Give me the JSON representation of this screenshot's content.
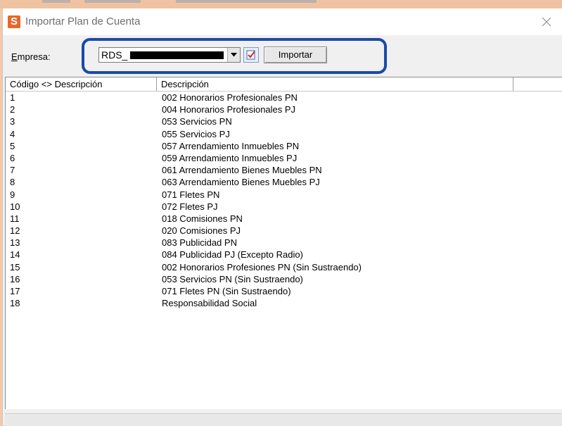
{
  "window": {
    "title": "Importar Plan de Cuenta",
    "icon_letter": "S"
  },
  "toolbar": {
    "empresa_label_underlined": "E",
    "empresa_label_rest": "mpresa:",
    "empresa_value": "RDS_",
    "import_label": "Importar"
  },
  "grid": {
    "headers": [
      "Código <> Descripción",
      "Descripción",
      ""
    ],
    "rows": [
      {
        "code": "1",
        "description": "002 Honorarios Profesionales PN"
      },
      {
        "code": "2",
        "description": "004 Honorarios Profesionales PJ"
      },
      {
        "code": "3",
        "description": "053 Servicios PN"
      },
      {
        "code": "4",
        "description": "055 Servicios PJ"
      },
      {
        "code": "5",
        "description": "057 Arrendamiento Inmuebles PN"
      },
      {
        "code": "6",
        "description": "059 Arrendamiento Inmuebles PJ"
      },
      {
        "code": "7",
        "description": "061 Arrendamiento Bienes Muebles PN"
      },
      {
        "code": "8",
        "description": "063 Arrendamiento Bienes Muebles PJ"
      },
      {
        "code": "9",
        "description": "071 Fletes PN"
      },
      {
        "code": "10",
        "description": "072 Fletes PJ"
      },
      {
        "code": "11",
        "description": "018 Comisiones PN"
      },
      {
        "code": "12",
        "description": "020 Comisiones PJ"
      },
      {
        "code": "13",
        "description": "083 Publicidad PN"
      },
      {
        "code": "14",
        "description": "084 Publicidad PJ (Excepto Radio)"
      },
      {
        "code": "15",
        "description": "002 Honorarios Profesiones PN (Sin Sustraendo)"
      },
      {
        "code": "16",
        "description": "053 Servicios PN (Sin Sustraendo)"
      },
      {
        "code": "17",
        "description": "071 Fletes PN (Sin Sustraendo)"
      },
      {
        "code": "18",
        "description": "Responsabilidad Social"
      }
    ]
  },
  "colors": {
    "highlight": "#1b4aa6",
    "app_icon": "#e8662a",
    "desktop": "#f3c9a9"
  },
  "icons": {
    "close": "close-icon",
    "dropdown": "chevron-down-icon",
    "pick": "checklist-icon"
  }
}
